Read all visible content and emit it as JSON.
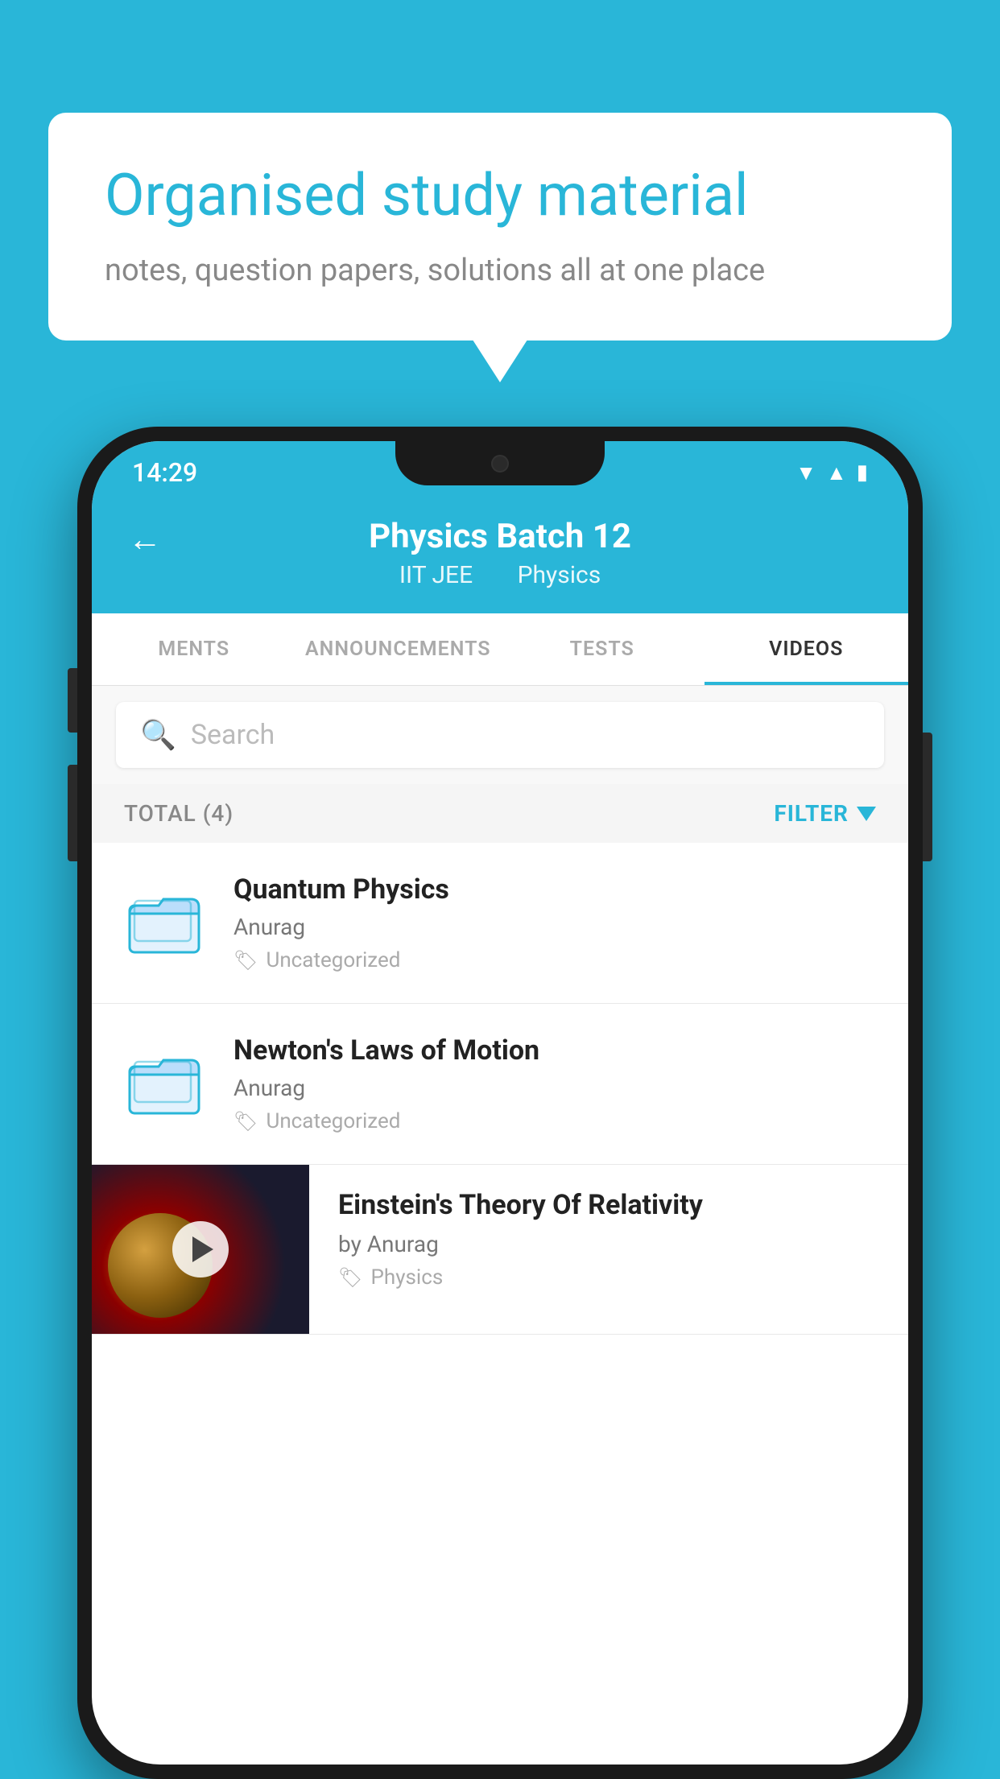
{
  "background": {
    "color": "#29b6d8"
  },
  "speech_bubble": {
    "title": "Organised study material",
    "subtitle": "notes, question papers, solutions all at one place"
  },
  "phone": {
    "status_bar": {
      "time": "14:29"
    },
    "header": {
      "title": "Physics Batch 12",
      "subtitle_left": "IIT JEE",
      "subtitle_right": "Physics",
      "back_label": "←"
    },
    "tabs": [
      {
        "label": "MENTS",
        "active": false
      },
      {
        "label": "ANNOUNCEMENTS",
        "active": false
      },
      {
        "label": "TESTS",
        "active": false
      },
      {
        "label": "VIDEOS",
        "active": true
      }
    ],
    "search": {
      "placeholder": "Search"
    },
    "filter": {
      "total_label": "TOTAL (4)",
      "filter_label": "FILTER"
    },
    "videos": [
      {
        "id": 1,
        "title": "Quantum Physics",
        "author": "Anurag",
        "tag": "Uncategorized",
        "type": "folder"
      },
      {
        "id": 2,
        "title": "Newton's Laws of Motion",
        "author": "Anurag",
        "tag": "Uncategorized",
        "type": "folder"
      },
      {
        "id": 3,
        "title": "Einstein's Theory Of Relativity",
        "author": "by Anurag",
        "tag": "Physics",
        "type": "thumbnail"
      }
    ]
  }
}
